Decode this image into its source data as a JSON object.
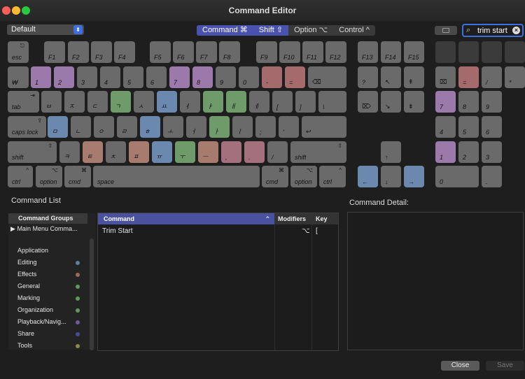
{
  "window": {
    "title": "Command Editor"
  },
  "toolbar": {
    "preset": "Default",
    "preset_arrow": "⬍",
    "modifiers": [
      {
        "label": "Command ⌘",
        "active": true
      },
      {
        "label": "Shift ⇧",
        "active": true
      },
      {
        "label": "Option ⌥",
        "active": false
      },
      {
        "label": "Control ^",
        "active": false
      }
    ],
    "search_value": "trim start",
    "search_icon": "⌕",
    "clear_glyph": "×"
  },
  "colors": {
    "accent": "#3e6fe0",
    "purple": "#9c79ab",
    "green": "#6f9b6a",
    "blue": "#6b88ae",
    "red": "#a56a6c",
    "salmon": "#a77c6e",
    "pink": "#a4707d",
    "key": "#6a6a6a",
    "key_dim": "#3b3b3b"
  },
  "keyboard": {
    "main_rows": [
      [
        {
          "label": "esc",
          "top": "⎋"
        },
        {
          "label": "F1"
        },
        {
          "label": "F2"
        },
        {
          "label": "F3"
        },
        {
          "label": "F4"
        },
        {
          "label": "F5"
        },
        {
          "label": "F6"
        },
        {
          "label": "F7"
        },
        {
          "label": "F8"
        },
        {
          "label": "F9"
        },
        {
          "label": "F10"
        },
        {
          "label": "F11"
        },
        {
          "label": "F12"
        }
      ],
      [
        {
          "label": "₩"
        },
        {
          "label": "1",
          "color": "purple"
        },
        {
          "label": "2",
          "color": "purple"
        },
        {
          "label": "3"
        },
        {
          "label": "4"
        },
        {
          "label": "5"
        },
        {
          "label": "6"
        },
        {
          "label": "7",
          "color": "purple"
        },
        {
          "label": "8",
          "color": "purple"
        },
        {
          "label": "9"
        },
        {
          "label": "0"
        },
        {
          "label": "-",
          "color": "red"
        },
        {
          "label": "=",
          "color": "red"
        },
        {
          "label": "⌫"
        }
      ],
      [
        {
          "label": "tab",
          "top": "⇥"
        },
        {
          "label": "ㅂ"
        },
        {
          "label": "ㅈ"
        },
        {
          "label": "ㄷ"
        },
        {
          "label": "ㄱ",
          "color": "green"
        },
        {
          "label": "ㅅ"
        },
        {
          "label": "ㅛ",
          "color": "blue"
        },
        {
          "label": "ㅕ"
        },
        {
          "label": "ㅑ",
          "color": "green"
        },
        {
          "label": "ㅐ",
          "color": "green"
        },
        {
          "label": "ㅔ"
        },
        {
          "label": "["
        },
        {
          "label": "]"
        },
        {
          "label": "\\"
        }
      ],
      [
        {
          "label": "caps lock",
          "top": "⇪"
        },
        {
          "label": "ㅁ",
          "color": "blue"
        },
        {
          "label": "ㄴ"
        },
        {
          "label": "ㅇ"
        },
        {
          "label": "ㄹ"
        },
        {
          "label": "ㅎ",
          "color": "blue"
        },
        {
          "label": "ㅗ"
        },
        {
          "label": "ㅓ"
        },
        {
          "label": "ㅏ",
          "color": "green"
        },
        {
          "label": "ㅣ"
        },
        {
          "label": ";"
        },
        {
          "label": "'"
        },
        {
          "label": "↩"
        }
      ],
      [
        {
          "label": "shift",
          "top": "⇧"
        },
        {
          "label": "ㅋ"
        },
        {
          "label": "ㅌ",
          "color": "salmon"
        },
        {
          "label": "ㅊ"
        },
        {
          "label": "ㅍ",
          "color": "salmon"
        },
        {
          "label": "ㅠ",
          "color": "blue"
        },
        {
          "label": "ㅜ",
          "color": "green"
        },
        {
          "label": "ㅡ",
          "color": "salmon"
        },
        {
          "label": ",",
          "color": "pink"
        },
        {
          "label": ".",
          "color": "pink"
        },
        {
          "label": "/"
        },
        {
          "label": "shift",
          "top": "⇧"
        }
      ],
      [
        {
          "label": "ctrl",
          "top": "^"
        },
        {
          "label": "option",
          "top": "⌥"
        },
        {
          "label": "cmd",
          "top": "⌘"
        },
        {
          "label": "space"
        },
        {
          "label": "cmd",
          "top": "⌘"
        },
        {
          "label": "option",
          "top": "⌥"
        },
        {
          "label": "ctrl",
          "top": "^"
        }
      ]
    ],
    "nav_keys": [
      {
        "label": "F13"
      },
      {
        "label": "F14"
      },
      {
        "label": "F15"
      },
      {
        "label": "?"
      },
      {
        "label": "↖"
      },
      {
        "label": "⇞"
      },
      {
        "label": "⌦"
      },
      {
        "label": "↘"
      },
      {
        "label": "⇟"
      },
      {
        "label": "↑"
      },
      {
        "label": "←",
        "color": "blue"
      },
      {
        "label": "↓"
      },
      {
        "label": "→",
        "color": "blue"
      }
    ],
    "numpad_keys": [
      {
        "label": "",
        "dim": true
      },
      {
        "label": "",
        "dim": true
      },
      {
        "label": "",
        "dim": true
      },
      {
        "label": "",
        "dim": true
      },
      {
        "label": "⌧"
      },
      {
        "label": "=",
        "color": "red"
      },
      {
        "label": "/"
      },
      {
        "label": "*"
      },
      {
        "label": "7",
        "color": "purple"
      },
      {
        "label": "8"
      },
      {
        "label": "9"
      },
      {
        "label": "4"
      },
      {
        "label": "5"
      },
      {
        "label": "6"
      },
      {
        "label": "1",
        "color": "purple"
      },
      {
        "label": "2"
      },
      {
        "label": "3"
      },
      {
        "label": "0"
      },
      {
        "label": "."
      }
    ]
  },
  "command_list": {
    "title": "Command List",
    "groups_header": "Command Groups",
    "top_item": "Main Menu Comma...",
    "groups": [
      {
        "name": "Application",
        "dot": ""
      },
      {
        "name": "Editing",
        "dot": "#5b7ea6"
      },
      {
        "name": "Effects",
        "dot": "#9e6a5a"
      },
      {
        "name": "General",
        "dot": "#5e9a5c"
      },
      {
        "name": "Marking",
        "dot": "#5e9a5c"
      },
      {
        "name": "Organization",
        "dot": "#5e9a5c"
      },
      {
        "name": "Playback/Navig...",
        "dot": "#6e5a9a"
      },
      {
        "name": "Share",
        "dot": "#4a4a9a"
      },
      {
        "name": "Tools",
        "dot": "#8a8a4a"
      }
    ],
    "columns": {
      "command": "Command",
      "sort": "⌃",
      "modifiers": "Modifiers",
      "key": "Key"
    },
    "rows": [
      {
        "command": "Trim Start",
        "modifiers": "⌥",
        "key": "["
      }
    ]
  },
  "detail": {
    "title": "Command Detail:"
  },
  "footer": {
    "close": "Close",
    "save": "Save"
  }
}
